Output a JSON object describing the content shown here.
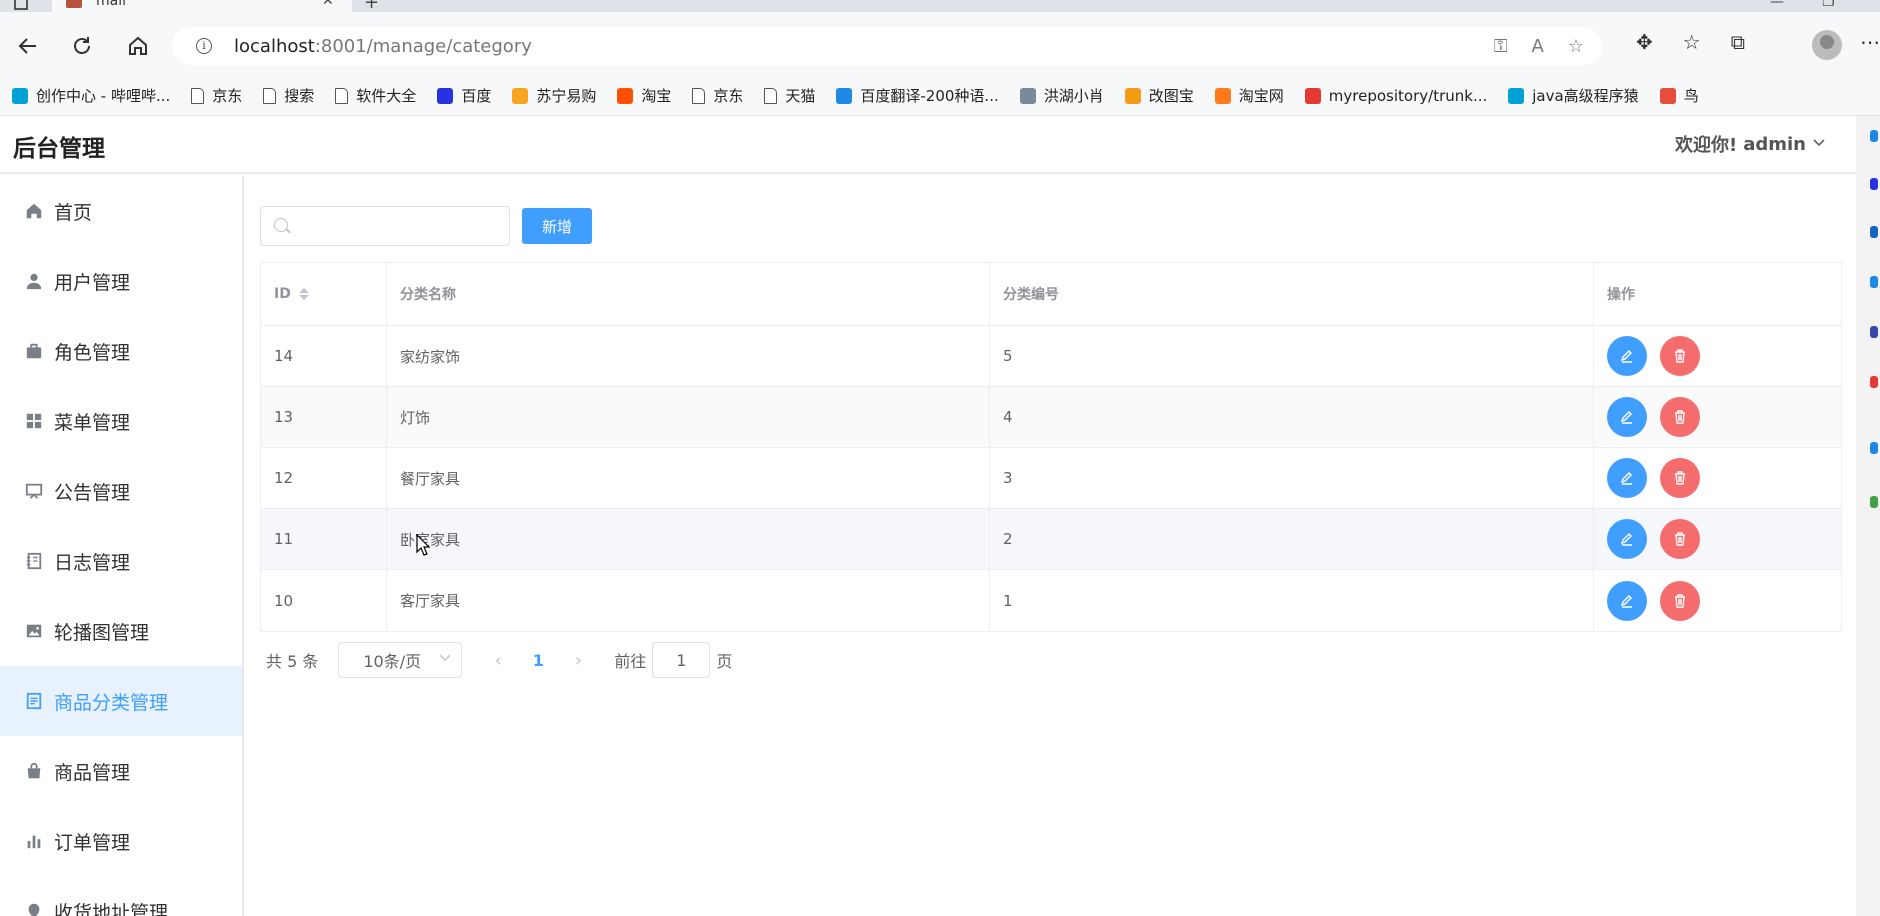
{
  "browser": {
    "tab_title": "mall",
    "url_host": "localhost",
    "url_rest": ":8001/manage/category",
    "bookmarks": [
      {
        "label": "创作中心 - 哔哩哔...",
        "color": "#00a1d6",
        "icon": "bilibili-icon"
      },
      {
        "label": "京东",
        "color": "",
        "icon": "page-icon"
      },
      {
        "label": "搜索",
        "color": "",
        "icon": "page-icon"
      },
      {
        "label": "软件大全",
        "color": "",
        "icon": "page-icon"
      },
      {
        "label": "百度",
        "color": "#2932e1",
        "icon": "baidu-icon"
      },
      {
        "label": "苏宁易购",
        "color": "#f5a623",
        "icon": "suning-icon"
      },
      {
        "label": "淘宝",
        "color": "#ff5000",
        "icon": "taobao-icon"
      },
      {
        "label": "京东",
        "color": "",
        "icon": "page-icon"
      },
      {
        "label": "天猫",
        "color": "",
        "icon": "page-icon"
      },
      {
        "label": "百度翻译-200种语...",
        "color": "#1e88e5",
        "icon": "translate-icon"
      },
      {
        "label": "洪湖小肖",
        "color": "#7a8a9a",
        "icon": "bird-icon"
      },
      {
        "label": "改图宝",
        "color": "#f39c12",
        "icon": "gaitubao-icon"
      },
      {
        "label": "淘宝网",
        "color": "#ff7a1a",
        "icon": "taobao-icon"
      },
      {
        "label": "myrepository/trunk...",
        "color": "#e53935",
        "icon": "chrome-icon"
      },
      {
        "label": "java高级程序猿",
        "color": "#00a1d6",
        "icon": "bilibili-icon"
      },
      {
        "label": "鸟",
        "color": "#e74c3c",
        "icon": "bird-icon"
      }
    ]
  },
  "app": {
    "title": "后台管理",
    "welcome": "欢迎你!",
    "user": "admin"
  },
  "sidebar": {
    "items": [
      {
        "label": "首页",
        "icon": "home-icon",
        "active": false
      },
      {
        "label": "用户管理",
        "icon": "user-icon",
        "active": false
      },
      {
        "label": "角色管理",
        "icon": "briefcase-icon",
        "active": false
      },
      {
        "label": "菜单管理",
        "icon": "grid-icon",
        "active": false
      },
      {
        "label": "公告管理",
        "icon": "board-icon",
        "active": false
      },
      {
        "label": "日志管理",
        "icon": "notebook-icon",
        "active": false
      },
      {
        "label": "轮播图管理",
        "icon": "picture-icon",
        "active": false
      },
      {
        "label": "商品分类管理",
        "icon": "document-icon",
        "active": true
      },
      {
        "label": "商品管理",
        "icon": "shopping-bag-icon",
        "active": false
      },
      {
        "label": "订单管理",
        "icon": "bar-chart-icon",
        "active": false
      },
      {
        "label": "收货地址管理",
        "icon": "location-icon",
        "active": false
      }
    ]
  },
  "toolbar": {
    "search_placeholder": "",
    "add_label": "新增"
  },
  "table": {
    "columns": [
      "ID",
      "分类名称",
      "分类编号",
      "操作"
    ],
    "rows": [
      {
        "id": "14",
        "name": "家纺家饰",
        "code": "5"
      },
      {
        "id": "13",
        "name": "灯饰",
        "code": "4"
      },
      {
        "id": "12",
        "name": "餐厅家具",
        "code": "3"
      },
      {
        "id": "11",
        "name": "卧室家具",
        "code": "2"
      },
      {
        "id": "10",
        "name": "客厅家具",
        "code": "1"
      }
    ]
  },
  "pagination": {
    "total": "共 5 条",
    "page_size": "10条/页",
    "current_page": "1",
    "goto_label": "前往",
    "goto_value": "1",
    "page_suffix": "页"
  },
  "colors": {
    "primary": "#409eff",
    "danger": "#f56c6c",
    "active_bg": "#e8f2fe"
  }
}
